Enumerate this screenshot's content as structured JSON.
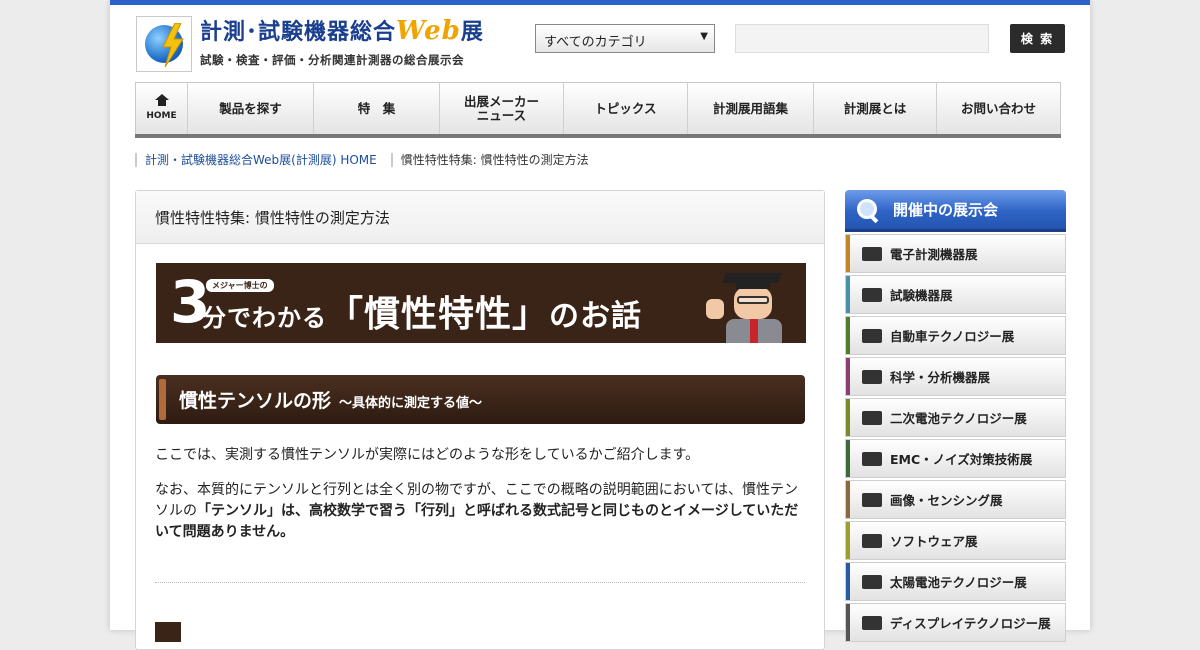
{
  "header": {
    "logo_title_main": "計測･試験機器総合",
    "logo_title_web": "Web",
    "logo_title_ten": "展",
    "logo_subtitle": "試験・検査・評価・分析関連計測器の総合展示会",
    "category_select": "すべてのカテゴリ",
    "search_placeholder": "",
    "search_button": "検 索"
  },
  "nav": [
    {
      "label": "HOME"
    },
    {
      "label": "製品を探す"
    },
    {
      "label": "特　集"
    },
    {
      "label": "出展メーカー\nニュース"
    },
    {
      "label": "トピックス"
    },
    {
      "label": "計測展用語集"
    },
    {
      "label": "計測展とは"
    },
    {
      "label": "お問い合わせ"
    }
  ],
  "breadcrumb": {
    "home": "計測・試験機器総合Web展(計測展) HOME",
    "current": "慣性特性特集: 慣性特性の測定方法"
  },
  "main": {
    "title": "慣性特性特集: 慣性特性の測定方法",
    "banner": {
      "badge": "メジャー博士の",
      "num": "3",
      "text_a": "分でわかる",
      "text_b": "「慣性特性」",
      "text_c": "のお話"
    },
    "section_title": "慣性テンソルの形",
    "section_sub": "～具体的に測定する値～",
    "p1": "ここでは、実測する慣性テンソルが実際にはどのような形をしているかご紹介します。",
    "p2_a": "なお、本質的にテンソルと行列とは全く別の物ですが、ここでの概略の説明範囲においては、慣性テンソルの",
    "p2_b": "「テンソル」は、高校数学で習う「行列」と呼ばれる数式記号と同じものとイメージしていただいて問題ありません。"
  },
  "side": {
    "title": "開催中の展示会",
    "items": [
      {
        "label": "電子計測機器展",
        "color": "#c0872a"
      },
      {
        "label": "試験機器展",
        "color": "#4a8fa8"
      },
      {
        "label": "自動車テクノロジー展",
        "color": "#4f7d2c"
      },
      {
        "label": "科学・分析機器展",
        "color": "#8a3f6e"
      },
      {
        "label": "二次電池テクノロジー展",
        "color": "#7a8a2a"
      },
      {
        "label": "EMC・ノイズ対策技術展",
        "color": "#3f6a38"
      },
      {
        "label": "画像・センシング展",
        "color": "#8a6a3a"
      },
      {
        "label": "ソフトウェア展",
        "color": "#9aa02a"
      },
      {
        "label": "太陽電池テクノロジー展",
        "color": "#2a5aa0"
      },
      {
        "label": "ディスプレイテクノロジー展",
        "color": "#555555"
      }
    ]
  }
}
